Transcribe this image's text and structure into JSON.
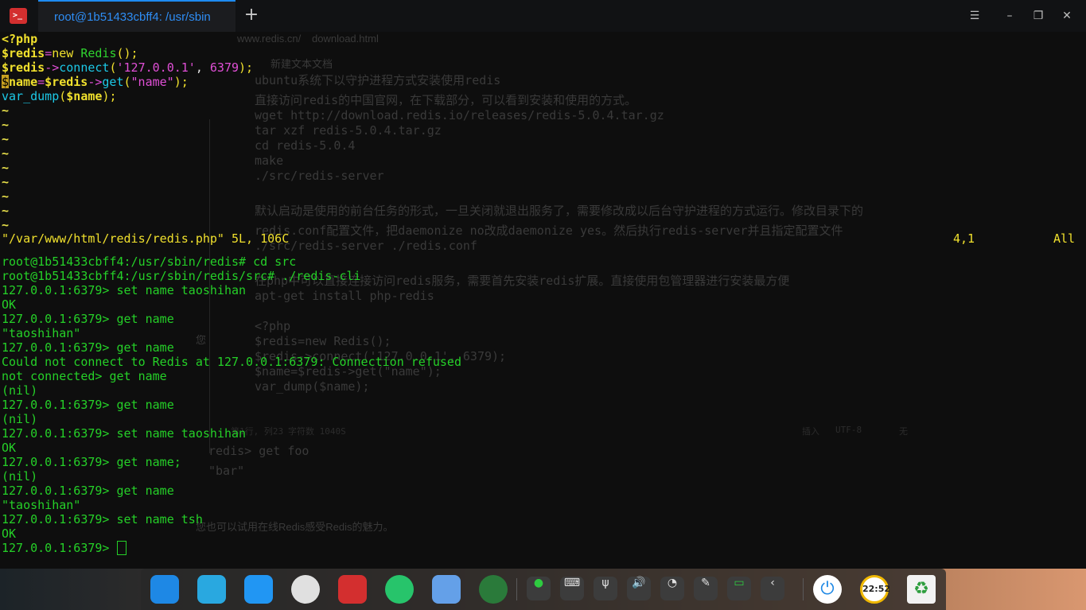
{
  "window": {
    "tab_title": "root@1b51433cbff4: /usr/sbin",
    "new_tab_symbol": "+",
    "menu_symbol": "☰",
    "minimize_symbol": "–",
    "restore_symbol": "❐",
    "close_symbol": "✕",
    "app_icon_text": ">_"
  },
  "background": {
    "url": "www.redis.cn/",
    "url_tail": "download.html",
    "editor_tab": "新建文本文档",
    "lines": [
      "ubuntu系统下以守护进程方式安装使用redis",
      "直接访问redis的中国官网，在下载部分，可以看到安装和使用的方式。",
      "wget http://download.redis.io/releases/redis-5.0.4.tar.gz",
      "tar xzf redis-5.0.4.tar.gz",
      "cd redis-5.0.4",
      "make",
      "./src/redis-server",
      "默认启动是使用的前台任务的形式，一旦关闭就退出服务了，需要修改成以后台守护进程的方式运行。修改目录下的",
      "redis.conf配置文件，把daemonize no改成daemonize yes。然后执行redis-server并且指定配置文件",
      "./src/redis-server ./redis.conf",
      "在php中可以直接连接访问redis服务，需要首先安装redis扩展。直接使用包管理器进行安装最方便",
      "apt-get install php-redis",
      "<?php",
      "$redis=new Redis();",
      "$redis->connect('127.0.0.1', 6379);",
      "$name=$redis->get(\"name\");",
      "var_dump($name);"
    ],
    "editor_status": [
      "第1行, 列23",
      "字符数 1040S",
      "插入",
      "UTF-8",
      "无"
    ],
    "redis_demo": [
      "redis> get foo",
      "\"bar\""
    ],
    "try_online": "您也可以试用在线Redis感受Redis的魅力。",
    "left_fragment": "您"
  },
  "vim": {
    "code": [
      [
        {
          "t": "<?php",
          "c": "php"
        }
      ],
      [
        {
          "t": "$redis",
          "c": "var"
        },
        {
          "t": "=",
          "c": "op"
        },
        {
          "t": "new",
          "c": "kw"
        },
        {
          "t": " Redis",
          "c": "cls"
        },
        {
          "t": "();",
          "c": "kw"
        }
      ],
      [
        {
          "t": "$redis",
          "c": "var"
        },
        {
          "t": "->",
          "c": "op"
        },
        {
          "t": "connect",
          "c": "fn"
        },
        {
          "t": "(",
          "c": "kw"
        },
        {
          "t": "'127.0.0.1'",
          "c": "str"
        },
        {
          "t": ", ",
          "c": "punc"
        },
        {
          "t": "6379",
          "c": "num"
        },
        {
          "t": ");",
          "c": "kw"
        }
      ],
      [
        {
          "t": "$",
          "c": "cursor"
        },
        {
          "t": "name",
          "c": "var"
        },
        {
          "t": "=",
          "c": "op"
        },
        {
          "t": "$redis",
          "c": "var"
        },
        {
          "t": "->",
          "c": "op"
        },
        {
          "t": "get",
          "c": "fn"
        },
        {
          "t": "(",
          "c": "kw"
        },
        {
          "t": "\"name\"",
          "c": "str"
        },
        {
          "t": ");",
          "c": "kw"
        }
      ],
      [
        {
          "t": "var_dump",
          "c": "fn"
        },
        {
          "t": "(",
          "c": "kw"
        },
        {
          "t": "$name",
          "c": "var"
        },
        {
          "t": ");",
          "c": "kw"
        }
      ]
    ],
    "tildes": [
      "~",
      "~",
      "~",
      "~",
      "~",
      "~",
      "~",
      "~",
      "~"
    ],
    "status_file": "\"/var/www/html/redis/redis.php\" 5L, 106C",
    "status_pos": "4,1",
    "status_all": "All"
  },
  "shell": {
    "lines": [
      "root@1b51433cbff4:/usr/sbin/redis# cd src",
      "root@1b51433cbff4:/usr/sbin/redis/src# ./redis-cli",
      "127.0.0.1:6379> set name taoshihan",
      "OK",
      "127.0.0.1:6379> get name",
      "\"taoshihan\"",
      "127.0.0.1:6379> get name",
      "Could not connect to Redis at 127.0.0.1:6379: Connection refused",
      "not connected> get name",
      "(nil)",
      "127.0.0.1:6379> get name",
      "(nil)",
      "127.0.0.1:6379> set name taoshihan",
      "OK",
      "127.0.0.1:6379> get name;",
      "(nil)",
      "127.0.0.1:6379> get name",
      "\"taoshihan\"",
      "127.0.0.1:6379> set name tsh",
      "OK"
    ],
    "prompt": "127.0.0.1:6379> "
  },
  "taskbar": {
    "apps": [
      {
        "name": "launcher-icon",
        "color": "#1e88e5"
      },
      {
        "name": "file-manager-icon",
        "color": "#29a8e0"
      },
      {
        "name": "video-player-icon",
        "color": "#2196f3"
      },
      {
        "name": "settings-icon",
        "color": "#e0e0e0"
      },
      {
        "name": "terminal-icon",
        "color": "#d32f2f"
      },
      {
        "name": "browser-icon",
        "color": "#27c46b"
      },
      {
        "name": "notes-icon",
        "color": "#64a0e8"
      },
      {
        "name": "camera-icon",
        "color": "#2a7a3a"
      }
    ],
    "tray": [
      {
        "name": "screen-record-icon",
        "glyph": "●"
      },
      {
        "name": "keyboard-icon",
        "glyph": "⌨"
      },
      {
        "name": "usb-icon",
        "glyph": "ψ"
      },
      {
        "name": "volume-icon",
        "glyph": "🔊"
      },
      {
        "name": "wifi-icon",
        "glyph": "◔"
      },
      {
        "name": "pen-icon",
        "glyph": "✎"
      },
      {
        "name": "battery-icon",
        "glyph": "▭"
      },
      {
        "name": "collapse-arrow-icon",
        "glyph": "‹"
      }
    ],
    "clock": "22:52",
    "power_glyph": "⏻",
    "trash_glyph": "♻"
  }
}
